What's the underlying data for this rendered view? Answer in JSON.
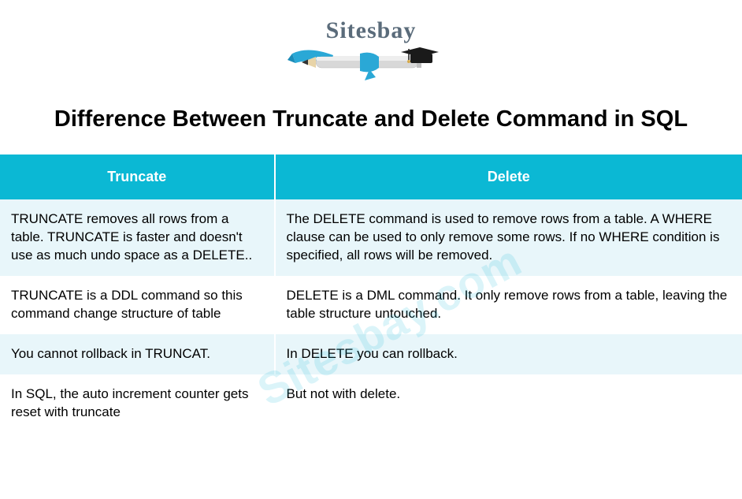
{
  "logo": {
    "text": "Sitesbay"
  },
  "title": "Difference Between Truncate and Delete Command in SQL",
  "watermark": "Sitesbay.com",
  "table": {
    "headers": {
      "left": "Truncate",
      "right": "Delete"
    },
    "rows": [
      {
        "left": "TRUNCATE removes all rows from a table. TRUNCATE is faster and doesn't use as much undo space as a DELETE..",
        "right": "The DELETE command is used to remove rows from a table. A WHERE clause can be used to only remove some rows. If no WHERE condition is specified, all rows will be removed."
      },
      {
        "left": "TRUNCATE is a DDL command so this command change structure of table",
        "right": "DELETE is a DML command. It only remove rows from a table, leaving the table structure untouched."
      },
      {
        "left": "You cannot rollback in TRUNCAT.",
        "right": "In DELETE you can rollback."
      },
      {
        "left": "In SQL, the auto increment counter gets reset with truncate",
        "right": "But not with delete."
      }
    ]
  }
}
